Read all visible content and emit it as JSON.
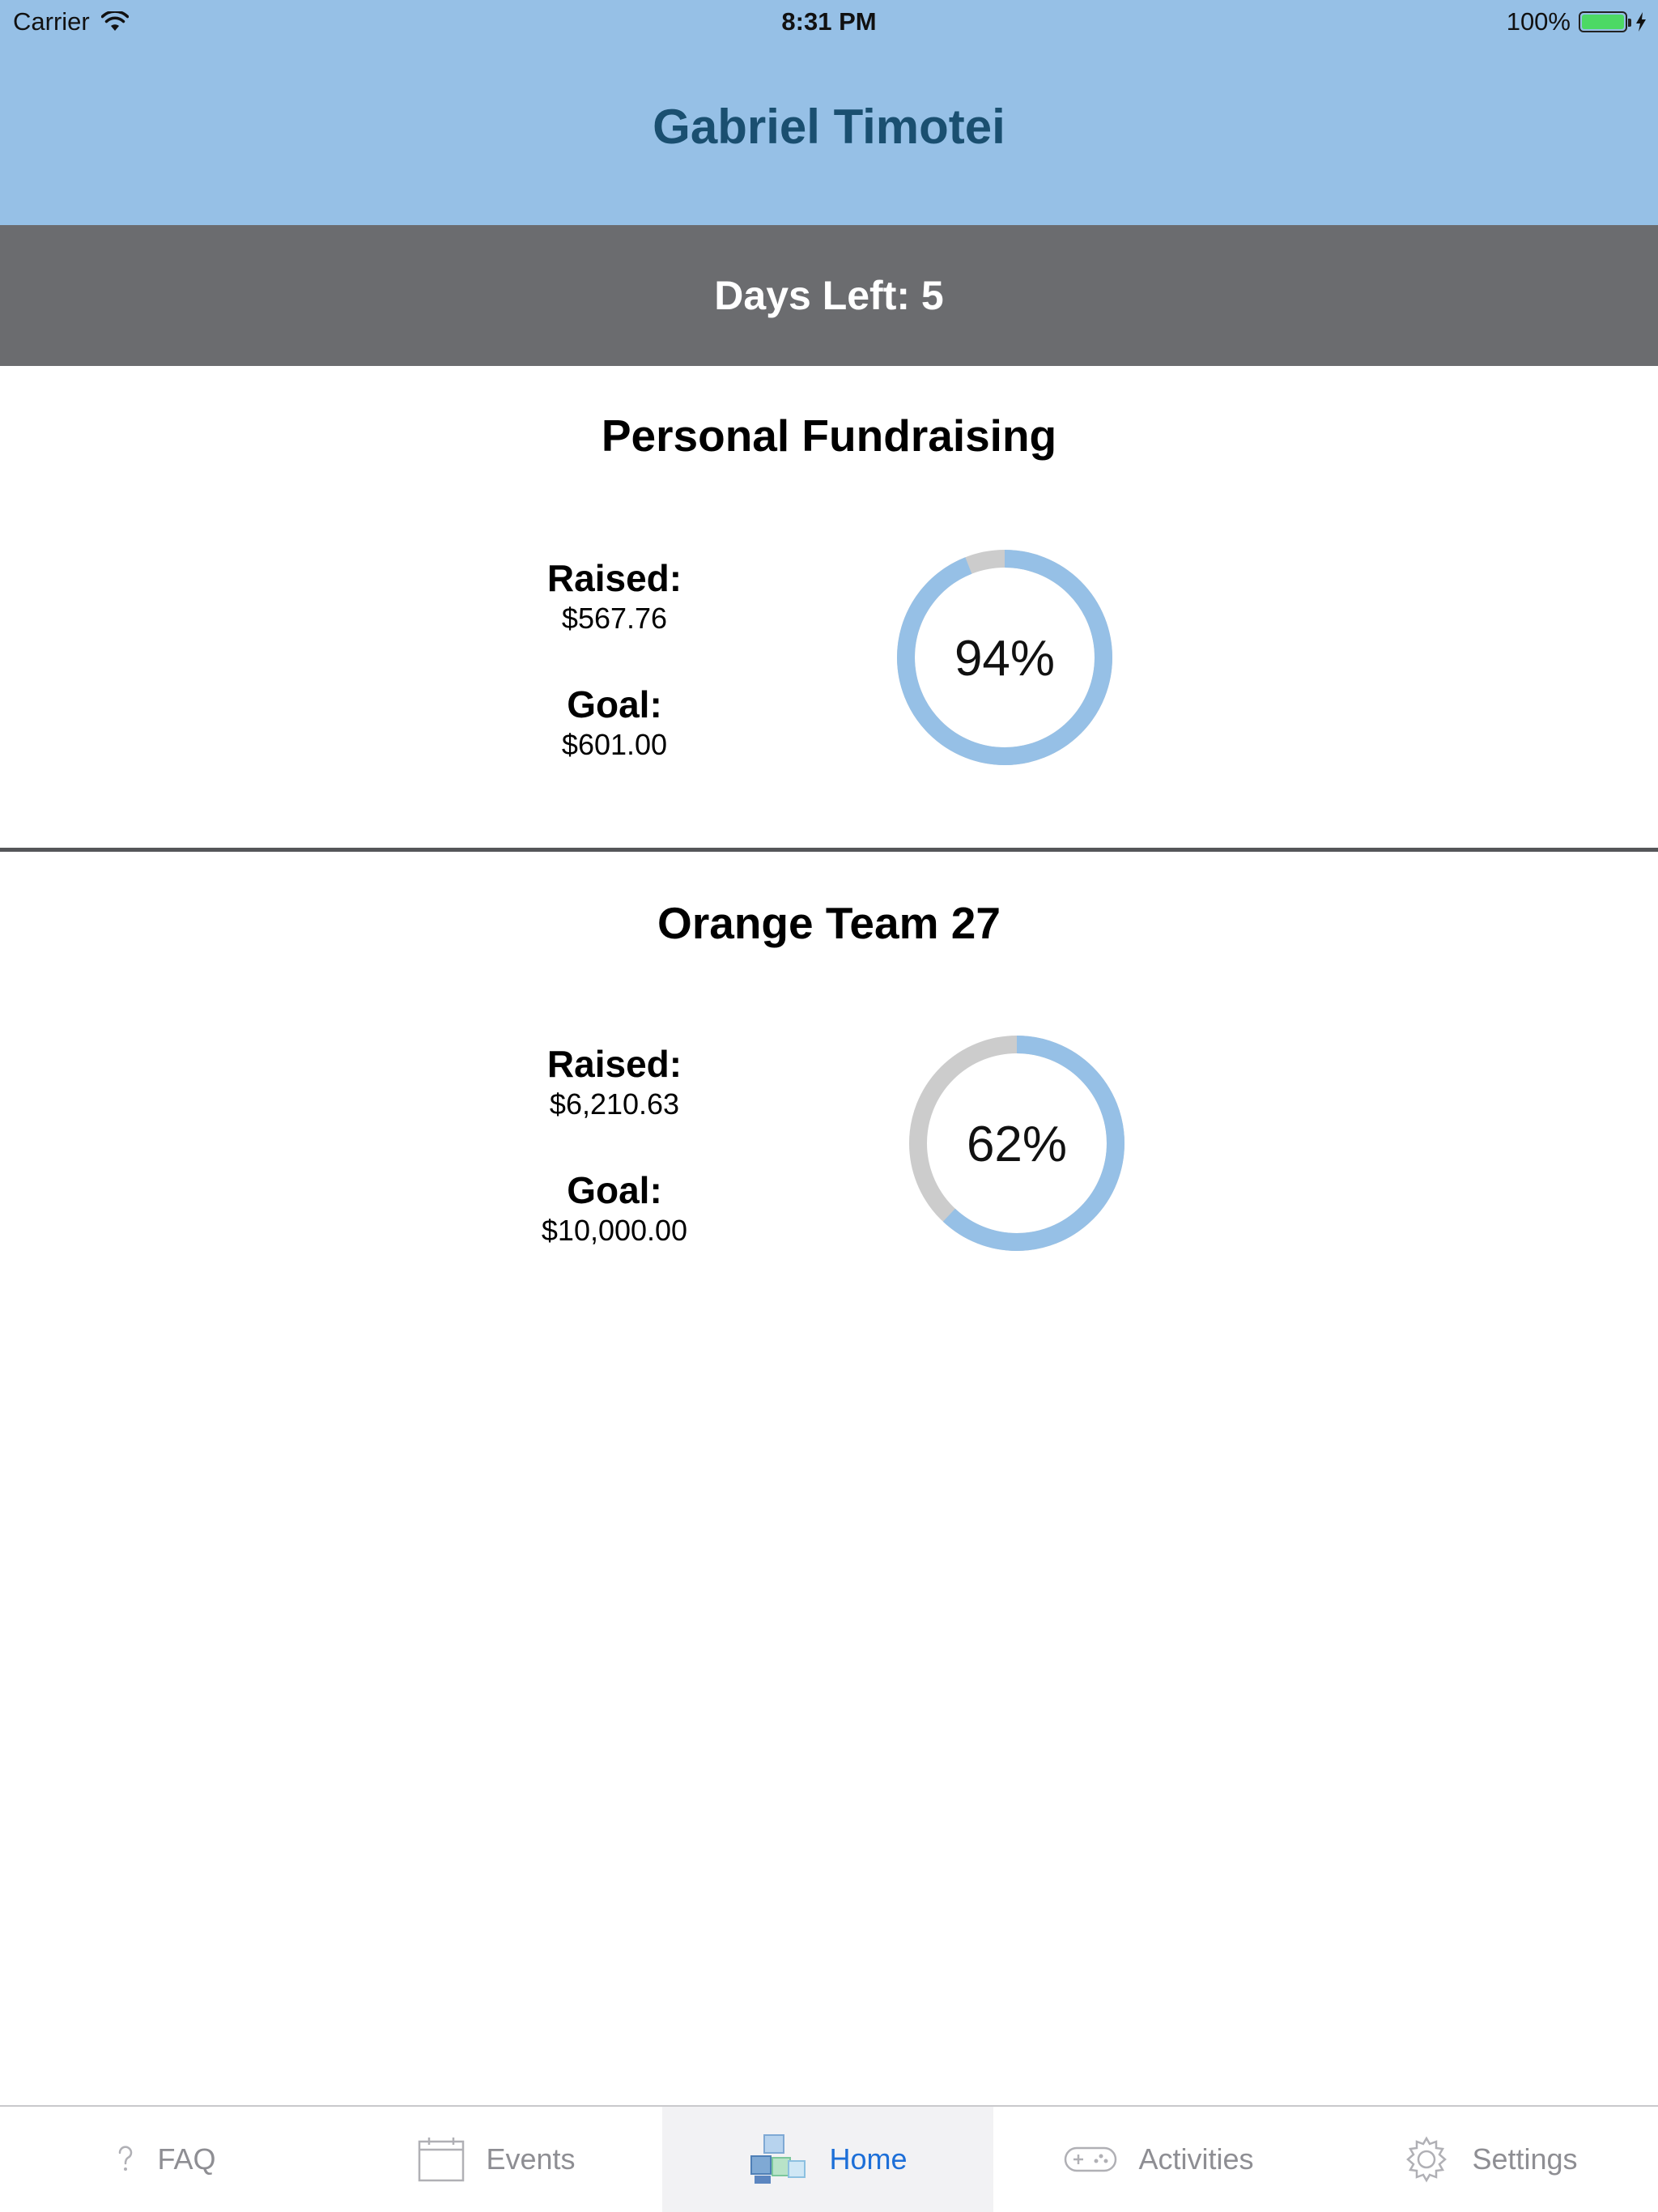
{
  "status_bar": {
    "carrier": "Carrier",
    "time": "8:31 PM",
    "battery": "100%",
    "icons": [
      "wifi-icon",
      "battery-icon",
      "charging-bolt-icon"
    ]
  },
  "header": {
    "title": "Gabriel Timotei",
    "background_color": "#96c0e6",
    "title_color": "#1a4f70"
  },
  "days_left": {
    "text": "Days Left: 5",
    "background_color": "#6b6c6f"
  },
  "personal": {
    "title": "Personal Fundraising",
    "raised_label": "Raised:",
    "raised_value": "$567.76",
    "goal_label": "Goal:",
    "goal_value": "$601.00",
    "percent_label": "94%",
    "progress": 0.94
  },
  "team": {
    "title": "Orange Team 27",
    "raised_label": "Raised:",
    "raised_value": "$6,210.63",
    "goal_label": "Goal:",
    "goal_value": "$10,000.00",
    "percent_label": "62%",
    "progress": 0.62
  },
  "donut_colors": {
    "progress": "#96c0e6",
    "remaining": "#cccccc"
  },
  "tabs": [
    {
      "label": "FAQ",
      "icon": "question-icon",
      "active": false
    },
    {
      "label": "Events",
      "icon": "calendar-icon",
      "active": false
    },
    {
      "label": "Home",
      "icon": "blocks-icon",
      "active": true
    },
    {
      "label": "Activities",
      "icon": "gamepad-icon",
      "active": false
    },
    {
      "label": "Settings",
      "icon": "gear-icon",
      "active": false
    }
  ],
  "accent_color": "#1d6fd8"
}
